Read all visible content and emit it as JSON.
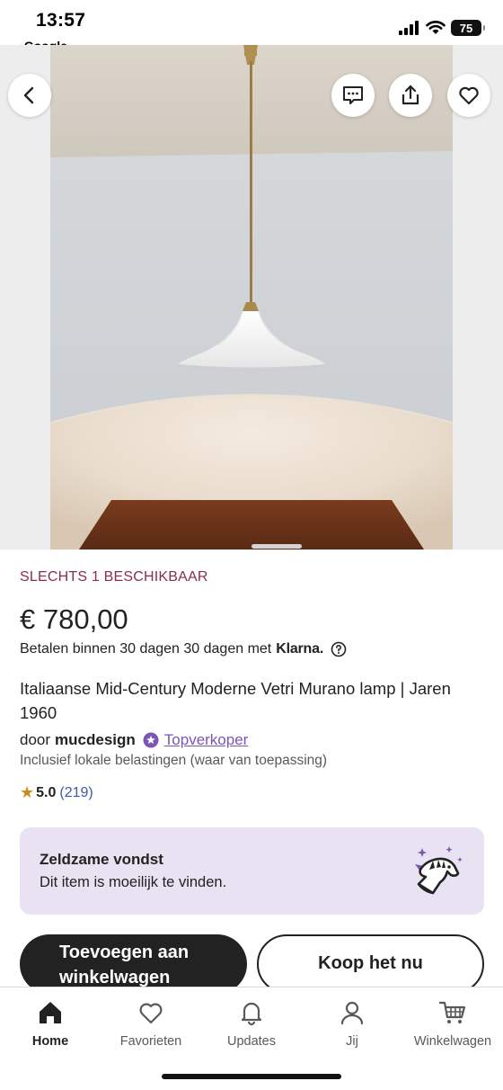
{
  "status_bar": {
    "time": "13:57",
    "back_app": "Google",
    "battery": "75"
  },
  "hero": {
    "icons": [
      "back-arrow-icon",
      "message-icon",
      "share-icon",
      "heart-icon"
    ]
  },
  "listing": {
    "availability": "SLECHTS 1 BESCHIKBAAR",
    "price": "€ 780,00",
    "payment_text": "Betalen binnen 30 dagen 30 dagen met",
    "payment_brand": "Klarna.",
    "title": "Italiaanse Mid-Century Moderne Vetri Murano lamp | Jaren 1960",
    "seller_prefix": "door",
    "seller_name": "mucdesign",
    "seller_badge": "Topverkoper",
    "tax_note": "Inclusief lokale belastingen (waar van toepassing)",
    "rating_score": "5.0",
    "rating_count": "(219)"
  },
  "rare_find": {
    "title": "Zeldzame vondst",
    "subtitle": "Dit item is moeilijk te vinden."
  },
  "actions": {
    "add_to_cart": "Toevoegen aan winkelwagen",
    "buy_now": "Koop het nu"
  },
  "bottom_nav": {
    "home": "Home",
    "favorites": "Favorieten",
    "updates": "Updates",
    "you": "Jij",
    "cart": "Winkelwagen",
    "active": "Home"
  },
  "colors": {
    "availability": "#8c2e47",
    "star_seller": "#7b57b5",
    "rating_count": "#3d5aa8",
    "rare_box_bg": "#e8e2f2",
    "primary_button": "#222222"
  }
}
